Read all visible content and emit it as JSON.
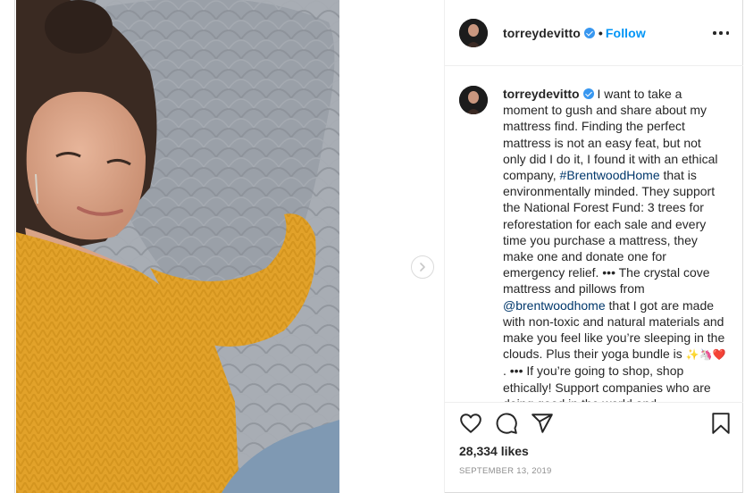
{
  "post": {
    "username": "torreydevitto",
    "separator": "•",
    "follow_label": "Follow",
    "caption_segments": [
      {
        "type": "text",
        "text": "I want to take a moment to gush and share about my mattress find. Finding the perfect mattress is not an easy feat, but not only did I do it, I found it with an ethical company, "
      },
      {
        "type": "link",
        "text": "#BrentwoodHome"
      },
      {
        "type": "text",
        "text": " that is environmentally minded. They support the National Forest Fund: 3 trees for reforestation for each sale and every time you purchase a mattress, they make one and donate one for emergency relief. ••• The crystal cove mattress and pillows from "
      },
      {
        "type": "link",
        "text": "@brentwoodhome"
      },
      {
        "type": "text",
        "text": " that I got are made with non-toxic and natural materials and make you feel like you’re sleeping in the clouds. Plus their yoga bundle is "
      },
      {
        "type": "text",
        "text": "✨🦄❤️"
      },
      {
        "type": "text",
        "text": " . ••• If you’re going to shop, shop ethically! Support companies who are doing good in the world and"
      }
    ],
    "likes": "28,334 likes",
    "date": "September 13, 2019"
  },
  "icons": {
    "next": "chevron-right-icon",
    "more": "more-options-icon",
    "like": "heart-icon",
    "comment": "comment-icon",
    "share": "share-icon",
    "save": "bookmark-icon",
    "verified": "verified-badge-icon"
  },
  "colors": {
    "accent": "#0095f6",
    "link": "#00376b",
    "text": "#262626",
    "muted": "#8e8e8e",
    "border": "#dbdbdb",
    "verified": "#3897f0"
  }
}
